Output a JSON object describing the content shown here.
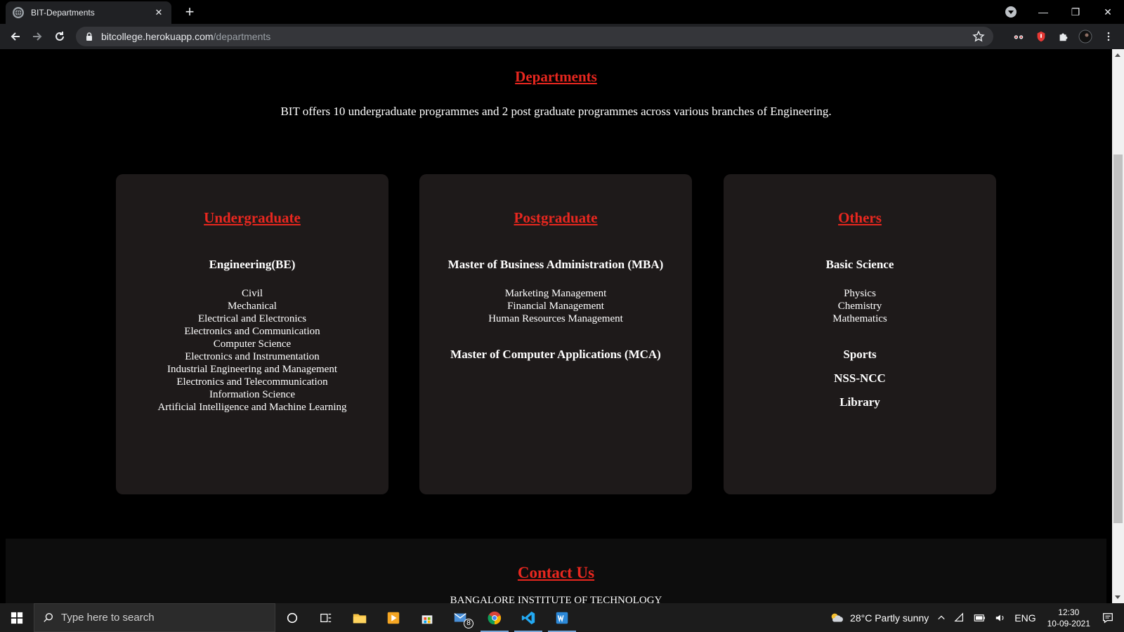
{
  "browser": {
    "tab_title": "BIT-Departments",
    "tab_close": "✕",
    "new_tab": "+",
    "url_host": "bitcollege.herokuapp.com",
    "url_path": "/departments",
    "window_controls": {
      "minimize": "—",
      "restore": "❐",
      "close": "✕"
    }
  },
  "page": {
    "title": "Departments",
    "intro": "BIT offers 10 undergraduate programmes and 2 post graduate programmes across various branches of Engineering.",
    "cards": [
      {
        "title": "Undergraduate",
        "groups": [
          {
            "heading": "Engineering(BE)",
            "items": [
              "Civil",
              "Mechanical",
              "Electrical and Electronics",
              "Electronics and Communication",
              "Computer Science",
              "Electronics and Instrumentation",
              "Industrial Engineering and Management",
              "Electronics and Telecommunication",
              "Information Science",
              "Artificial Intelligence and Machine Learning"
            ]
          }
        ]
      },
      {
        "title": "Postgraduate",
        "groups": [
          {
            "heading": "Master of Business Administration (MBA)",
            "items": [
              "Marketing Management",
              "Financial Management",
              "Human Resources Management"
            ]
          },
          {
            "heading": "Master of Computer Applications (MCA)",
            "items": []
          }
        ]
      },
      {
        "title": "Others",
        "groups": [
          {
            "heading": "Basic Science",
            "items": [
              "Physics",
              "Chemistry",
              "Mathematics"
            ]
          },
          {
            "heading": "Sports",
            "items": []
          },
          {
            "heading": "NSS-NCC",
            "items": []
          },
          {
            "heading": "Library",
            "items": []
          }
        ]
      }
    ],
    "contact": {
      "title": "Contact Us",
      "line1": "BANGALORE INSTITUTE OF TECHNOLOGY"
    }
  },
  "taskbar": {
    "search_placeholder": "Type here to search",
    "mail_badge": "8",
    "weather": "28°C  Partly sunny",
    "language": "ENG",
    "time": "12:30",
    "date": "10-09-2021"
  },
  "colors": {
    "accent_red": "#e8271f",
    "card_bg": "#1e1a1a",
    "page_bg": "#000000"
  }
}
